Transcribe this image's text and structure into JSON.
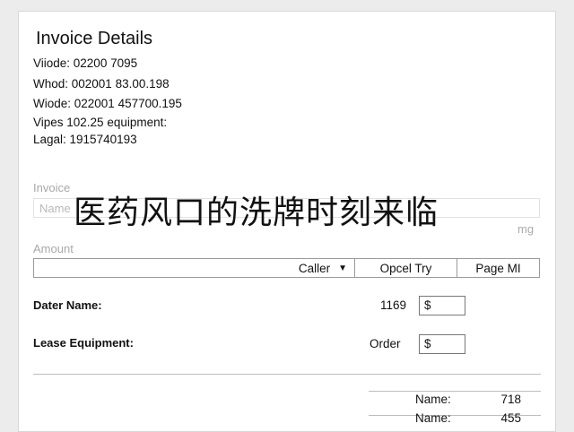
{
  "header": {
    "title": "Invoice Details"
  },
  "meta_lines": [
    "Viiode: 02200 7095",
    "Whod: 002001 83.00.198",
    "Wiode: 022001 457700.195",
    "Vipes 102.25 equipment:",
    "Lagal: 1915740193"
  ],
  "invoice_section": {
    "label": "Invoice",
    "name_placeholder": "Name",
    "unit": "mg"
  },
  "overlay_text": "医药风口的洗牌时刻来临",
  "amount_section": {
    "label": "Amount"
  },
  "toolbar": {
    "caller_label": "Caller",
    "opcel_label": "Opcel Try",
    "page_label": "Page MI"
  },
  "rows": [
    {
      "label": "Dater Name:",
      "inline": "1169",
      "currency": "$"
    },
    {
      "label": "Lease Equipment:",
      "inline": "Order",
      "currency": "$"
    }
  ],
  "summary": [
    {
      "label": "Name:",
      "value": "718"
    },
    {
      "label": "Name:",
      "value": "455"
    }
  ]
}
